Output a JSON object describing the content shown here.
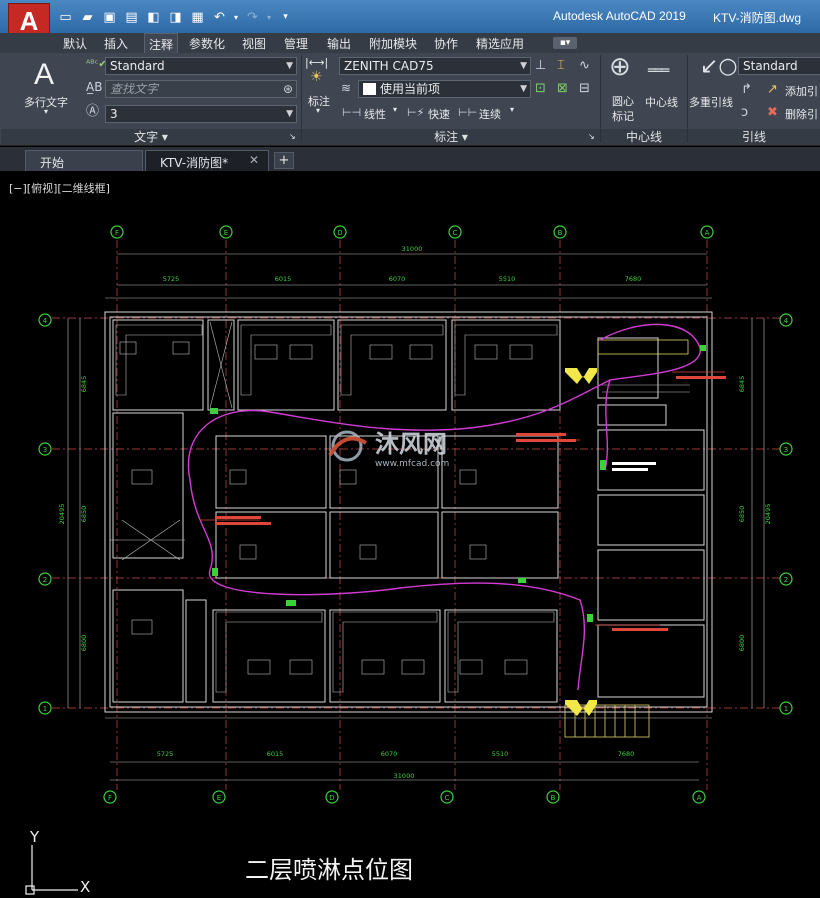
{
  "titlebar": {
    "logo": "A",
    "app_title": "Autodesk AutoCAD 2019",
    "doc_title": "KTV-消防图.dwg",
    "qat_icons": [
      "new-icon",
      "open-icon",
      "save-icon",
      "saveas-icon",
      "cloud-open-icon",
      "cloud-save-icon",
      "plot-icon",
      "undo-icon",
      "redo-icon",
      "dropdown-icon"
    ]
  },
  "ribbon_tabs": [
    "默认",
    "插入",
    "注释",
    "参数化",
    "视图",
    "管理",
    "输出",
    "附加模块",
    "协作",
    "精选应用"
  ],
  "ribbon_active_tab": "注释",
  "ribbon": {
    "text_panel": {
      "big_button": "多行文字",
      "style": "Standard",
      "search_placeholder": "查找文字",
      "height": "3",
      "panel_label": "文字 ▾"
    },
    "dim_panel": {
      "big_button": "标注",
      "style": "ZENITH CAD75",
      "layer": "使用当前项",
      "linear": "线性",
      "quick": "快速",
      "continue": "连续",
      "panel_label": "标注 ▾"
    },
    "centerline_panel": {
      "center_mark": "圆心\n标记",
      "center_line": "中心线",
      "panel_label": "中心线"
    },
    "leader_panel": {
      "big_button": "多重引线",
      "style": "Standard",
      "add": "添加引",
      "remove": "删除引",
      "panel_label": "引线"
    }
  },
  "doc_tabs": [
    {
      "label": "开始",
      "active": false
    },
    {
      "label": "KTV-消防图*",
      "active": true
    }
  ],
  "viewport_label": "[−][俯视][二维线框]",
  "drawing": {
    "title": "二层喷淋点位图",
    "watermark_cn": "沐风网",
    "watermark_url": "www.mfcad.com",
    "grid_top": [
      "F",
      "E",
      "D",
      "C",
      "B",
      "A"
    ],
    "grid_side": [
      "4",
      "3",
      "2",
      "1"
    ],
    "dims_top_total": "31000",
    "dims_top": [
      "5725",
      "6015",
      "6070",
      "5510",
      "7680"
    ],
    "dims_bottom": [
      "5725",
      "6015",
      "6070",
      "5510",
      "7680"
    ],
    "dims_bottom_total": "31000",
    "dims_left": [
      "6845",
      "6850",
      "6800"
    ],
    "dims_left_total": "20495",
    "dims_right": [
      "6845",
      "6850",
      "6800"
    ],
    "dims_right_total": "20495",
    "ucs_y": "Y",
    "ucs_x": "X"
  }
}
